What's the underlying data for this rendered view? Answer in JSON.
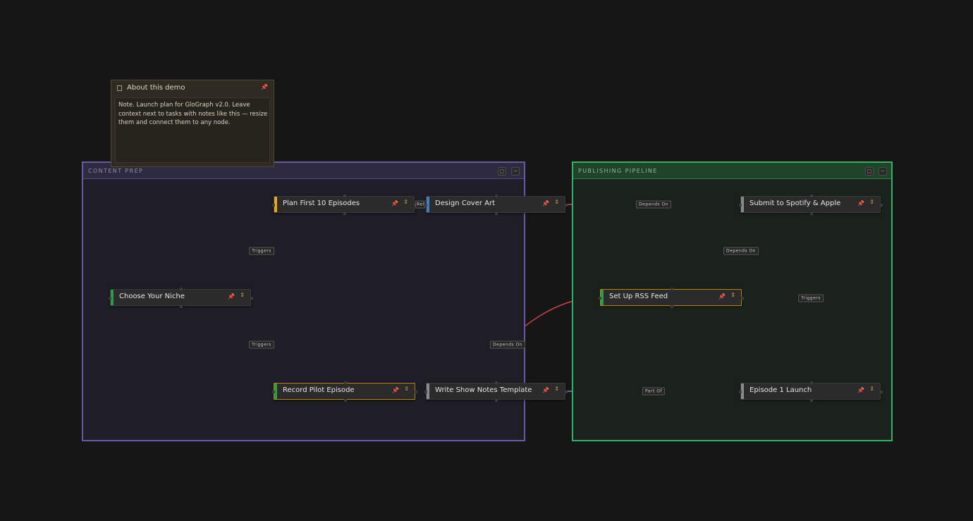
{
  "groups": {
    "content_prep": {
      "title": "CONTENT PREP",
      "color": "#665aa6"
    },
    "publishing_pipeline": {
      "title": "PUBLISHING PIPELINE",
      "color": "#2fb463"
    }
  },
  "note": {
    "title": "About this demo",
    "body": "Note. Launch plan for GloGraph v2.0. Leave context next to tasks with notes like this — resize them and connect them to any node.",
    "icon": "document-icon",
    "pin_icon": "pin-icon"
  },
  "nodes": {
    "choose_niche": {
      "label": "Choose Your Niche",
      "accent": "#2a9d4a"
    },
    "plan_episodes": {
      "label": "Plan First 10 Episodes",
      "accent": "#e6a817"
    },
    "record_pilot": {
      "label": "Record Pilot Episode",
      "accent": "#2a9d4a"
    },
    "design_cover": {
      "label": "Design Cover Art",
      "accent": "#3d7fc4"
    },
    "write_notes": {
      "label": "Write Show Notes Template",
      "accent": "#8a8a8a"
    },
    "set_up_rss": {
      "label": "Set Up RSS Feed",
      "accent": "#2a9d4a"
    },
    "submit_spotify": {
      "label": "Submit to Spotify & Apple",
      "accent": "#8a8a8a"
    },
    "episode_launch": {
      "label": "Episode 1 Launch",
      "accent": "#8a8a8a"
    }
  },
  "edge_labels": {
    "triggers": "Triggers",
    "depends_on": "Depends On",
    "part_of": "Part Of",
    "relates": "Relates"
  },
  "edge_colors": {
    "triggers": "#18a7c9",
    "depends_on": "#d94545",
    "part_of": "#7a7bc0",
    "relates": "#8a8a8a"
  },
  "icons": {
    "pin": "pin-icon",
    "chevron": "chevron-updown-icon",
    "lock": "lock-icon",
    "collapse": "minus-icon"
  }
}
